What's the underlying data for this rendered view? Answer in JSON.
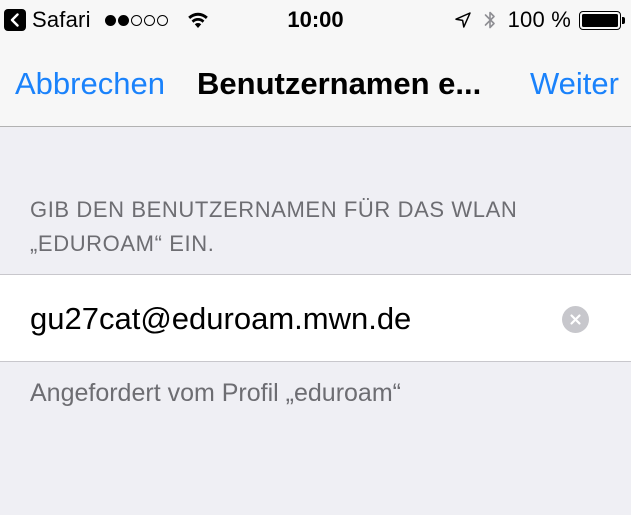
{
  "statusbar": {
    "back_app": "Safari",
    "signal_bars_filled": 2,
    "signal_bars_total": 5,
    "time": "10:00",
    "battery_text": "100 %",
    "battery_level": 1.0,
    "icons": [
      "back-arrow-icon",
      "signal-dots",
      "wifi-icon",
      "location-arrow-icon",
      "bluetooth-icon",
      "battery-icon"
    ]
  },
  "navbar": {
    "cancel_label": "Abbrechen",
    "title": "Benutzernamen e...",
    "next_label": "Weiter"
  },
  "form": {
    "section_header_line1": "GIB DEN BENUTZERNAMEN FÜR DAS WLAN",
    "section_header_line2": "„EDUROAM“ EIN.",
    "username_value": "gu27cat@eduroam.mwn.de",
    "footer_note": "Angefordert vom Profil „eduroam“"
  },
  "colors": {
    "tint": "#1a82fb",
    "background": "#efeff4",
    "bar_background": "#f7f7f7",
    "secondary_text": "#6d6d72",
    "clear_button": "#c7c7cc"
  }
}
